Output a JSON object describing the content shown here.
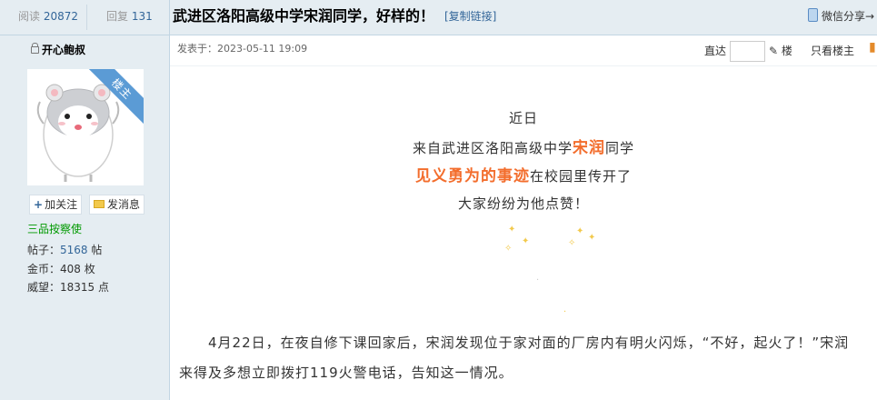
{
  "header": {
    "views_label": "阅读",
    "views_count": "20872",
    "replies_label": "回复",
    "replies_count": "131",
    "title": "武进区洛阳高级中学宋润同学，好样的！",
    "copy_link": "[复制链接]",
    "share": "微信分享→"
  },
  "author": {
    "name": "开心鲍叔",
    "badge": "楼主",
    "follow": "加关注",
    "message": "发消息",
    "rank": "三品按察使",
    "stats": [
      {
        "label": "帖子：",
        "value": "5168",
        "unit": " 帖",
        "blue": true
      },
      {
        "label": "金币：",
        "value": "408",
        "unit": " 枚",
        "blue": false
      },
      {
        "label": "威望：",
        "value": "18315",
        "unit": " 点",
        "blue": false
      }
    ]
  },
  "post": {
    "posted": "发表于：2023-05-11 19:09",
    "goto": "直达",
    "floor": "楼",
    "only_op": "只看楼主",
    "lines": {
      "l1": "近日",
      "l2_a": "来自武进区洛阳高级中学",
      "l2_b": "宋润",
      "l2_c": "同学",
      "l3_a": "见义勇为的事迹",
      "l3_b": "在校园里传开了",
      "l4": "大家纷纷为他点赞！"
    },
    "para1": "4月22日，在夜自修下课回家后，宋润发现位于家对面的厂房内有明火闪烁，“不好，起火了！”宋润",
    "para2": "来得及多想立即拨打119火警电话，告知这一情况。"
  },
  "colors": {
    "accent_blue": "#336699",
    "highlight_orange": "#f36d2c",
    "rank_green": "#009900",
    "header_bg": "#e5edf2"
  }
}
